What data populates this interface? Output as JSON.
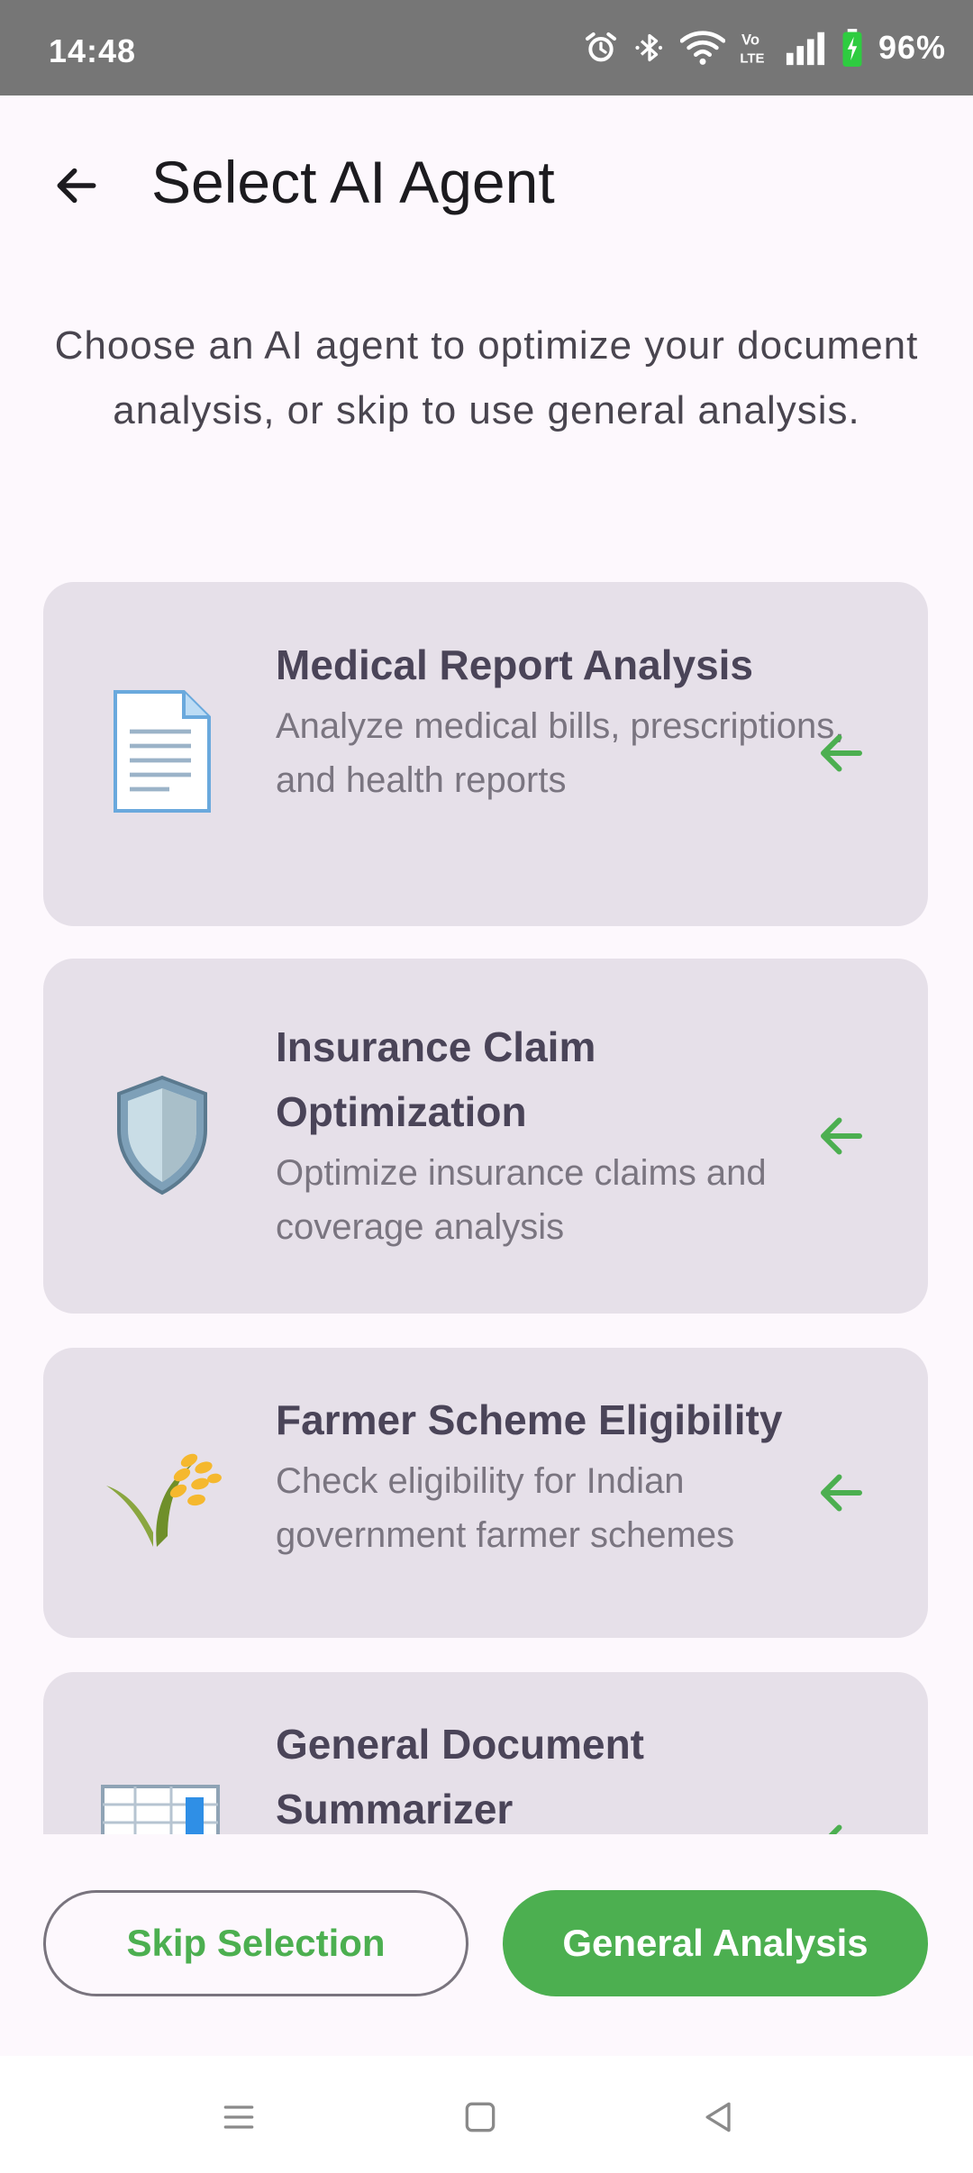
{
  "status_bar": {
    "time": "14:48",
    "battery_percent": "96%",
    "icons": [
      "alarm-icon",
      "bluetooth-icon",
      "wifi-icon",
      "volte-icon",
      "signal-icon",
      "battery-charging-icon"
    ]
  },
  "header": {
    "title": "Select AI Agent",
    "back_icon": "arrow-left-icon"
  },
  "intro_text": "Choose an AI agent to optimize your document analysis, or skip to use general analysis.",
  "agents": [
    {
      "title": "Medical Report Analysis",
      "description": "Analyze medical bills, prescriptions, and health reports",
      "icon": "document-icon"
    },
    {
      "title": "Insurance Claim Optimization",
      "description": "Optimize insurance claims and coverage analysis",
      "icon": "shield-icon"
    },
    {
      "title": "Farmer Scheme Eligibility",
      "description": "Check eligibility for Indian government farmer schemes",
      "icon": "rice-plant-icon"
    },
    {
      "title": "General Document Summarizer",
      "description": "",
      "icon": "spreadsheet-icon"
    }
  ],
  "buttons": {
    "skip": "Skip Selection",
    "general": "General Analysis"
  },
  "colors": {
    "accent_green": "#4caf50",
    "card_background": "#e6e0e9",
    "status_bar": "#767676",
    "page_background": "#fdf8fd"
  },
  "nav_bar": {
    "icons": [
      "menu-icon",
      "home-square-icon",
      "back-triangle-icon"
    ]
  }
}
